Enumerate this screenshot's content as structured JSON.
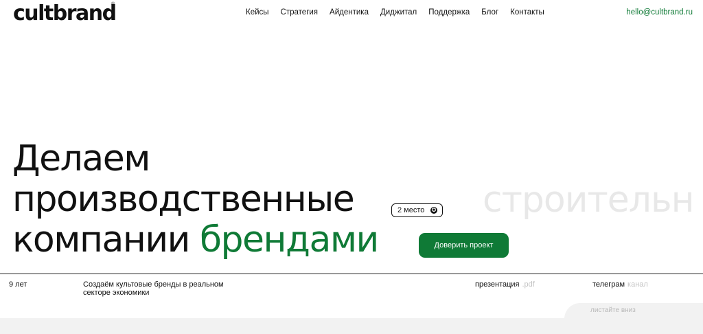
{
  "header": {
    "logo": "cultbrand",
    "logo_mark": "®",
    "nav": [
      {
        "label": "Кейсы"
      },
      {
        "label": "Стратегия"
      },
      {
        "label": "Айдентика"
      },
      {
        "label": "Диджитал"
      },
      {
        "label": "Поддержка"
      },
      {
        "label": "Блог"
      },
      {
        "label": "Контакты"
      }
    ],
    "email": "hello@cultbrand.ru"
  },
  "hero": {
    "line1": "Делаем",
    "line2": "производственные",
    "line3_prefix": "компании",
    "line3_accent": "брендами",
    "ticker_word": "строительн",
    "badge_text": "2 место",
    "badge_icon": "award-icon",
    "cta_label": "Доверить проект"
  },
  "info": {
    "years": "9 лет",
    "tagline": "Создаём культовые бренды в реальном секторе экономики",
    "presentation_label": "презентация",
    "presentation_ext": ".pdf",
    "telegram_label": "телеграм",
    "telegram_sub": "канал",
    "scroll_hint": "листайте вниз"
  },
  "colors": {
    "accent": "#0f7a36",
    "text": "#111111",
    "muted": "#c3c3c3",
    "band": "#f2f2f2"
  }
}
